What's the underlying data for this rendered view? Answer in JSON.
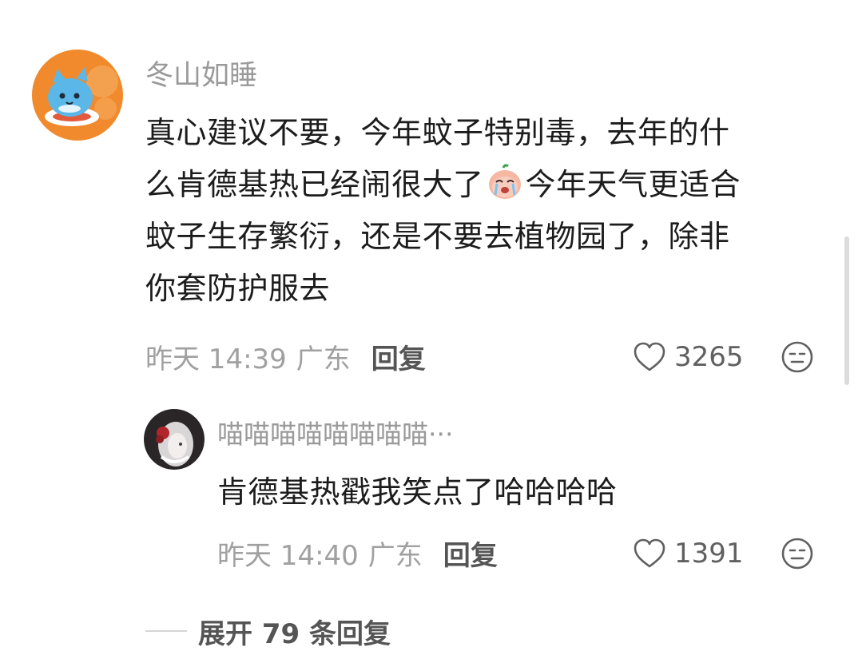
{
  "comment": {
    "username": "冬山如睡",
    "text_lines": [
      "真心建议不要，今年蚊子特别毒，去年的什",
      "么肯德基热已经闹很大了",
      "今年天气更适合",
      "蚊子生存繁衍，还是不要去植物园了，除非",
      "你套防护服去"
    ],
    "emoji": "crying-face-emoji",
    "time": "昨天 14:39",
    "location": "广东",
    "reply_label": "回复",
    "likes": "3265"
  },
  "reply": {
    "username": "喵喵喵喵喵喵喵喵···",
    "text": "肯德基热戳我笑点了哈哈哈哈",
    "time": "昨天 14:40",
    "location": "广东",
    "reply_label": "回复",
    "likes": "1391"
  },
  "expand": {
    "label": "展开 79 条回复"
  },
  "colors": {
    "meta_gray": "#a0a0a0",
    "username_gray": "#9a9a9a",
    "text_dark": "#1c1c1c",
    "avatar_orange": "#f08a2c"
  }
}
